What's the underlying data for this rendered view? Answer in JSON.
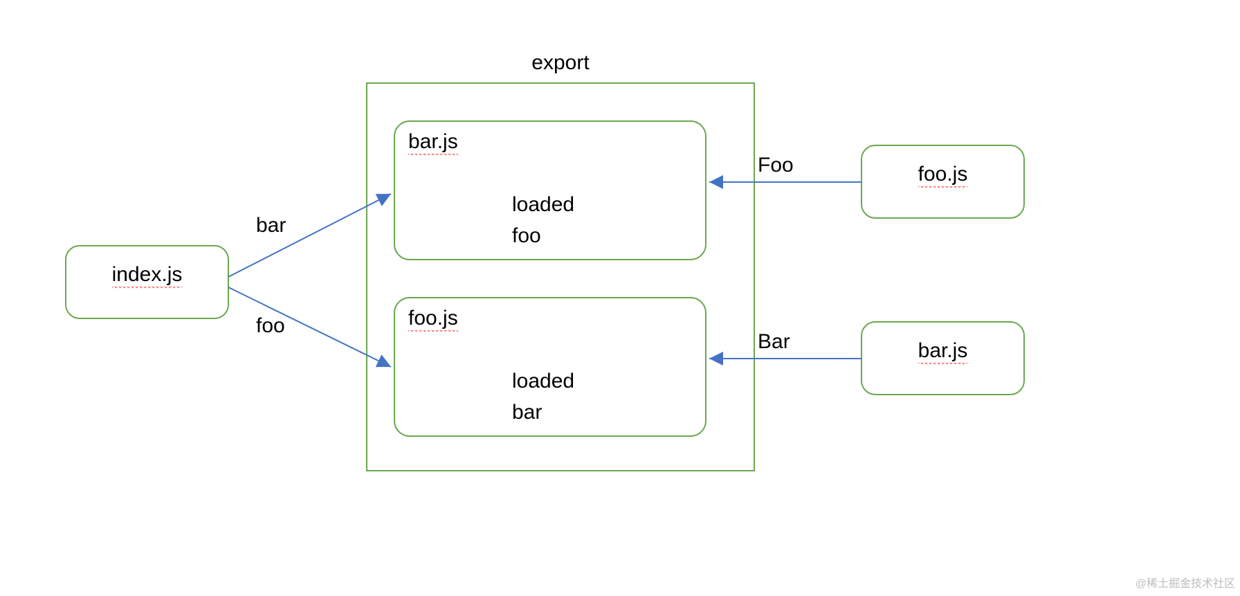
{
  "watermark": "@稀土掘金技术社区",
  "diagram": {
    "leftNode": {
      "label": "index.js"
    },
    "exportBox": {
      "title": "export",
      "modules": [
        {
          "name": "bar.js",
          "body": [
            "loaded",
            "foo"
          ]
        },
        {
          "name": "foo.js",
          "body": [
            "loaded",
            "bar"
          ]
        }
      ]
    },
    "rightNodes": [
      {
        "label": "foo.js"
      },
      {
        "label": "bar.js"
      }
    ],
    "edges": {
      "leftUpper": "bar",
      "leftLower": "foo",
      "rightUpper": "Foo",
      "rightLower": "Bar"
    }
  }
}
